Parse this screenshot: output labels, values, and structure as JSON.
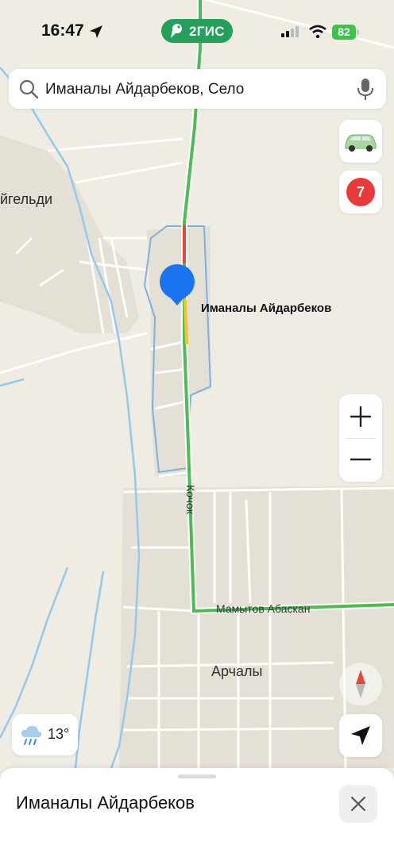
{
  "status_bar": {
    "time": "16:47",
    "brand": "2ГИС",
    "battery": "82"
  },
  "search": {
    "query": "Иманалы Айдарбеков, Село"
  },
  "map": {
    "labels": {
      "village_left": "йгельди",
      "selected_place": "Иманалы Айдарбеков",
      "road_vertical": "Кочок",
      "road_horizontal": "Мамытов Абаскан",
      "village_bottom": "Арчалы"
    },
    "traffic_score": "7"
  },
  "weather": {
    "temperature": "13°"
  },
  "bottom_sheet": {
    "title": "Иманалы Айдарбеков"
  },
  "colors": {
    "road_green": "#4cbd53",
    "road_red": "#e9463b",
    "road_yellow": "#f2c230",
    "pin_blue": "#1a73f0",
    "boundary_blue": "#7fb0e0",
    "river": "#93c9ea",
    "settlement": "#e4e0d6"
  },
  "icons": {
    "search": "search-icon",
    "mic": "microphone-icon",
    "car": "car-icon",
    "compass": "compass-icon",
    "locate": "location-arrow-icon",
    "weather": "rain-cloud-icon",
    "close": "close-icon"
  }
}
